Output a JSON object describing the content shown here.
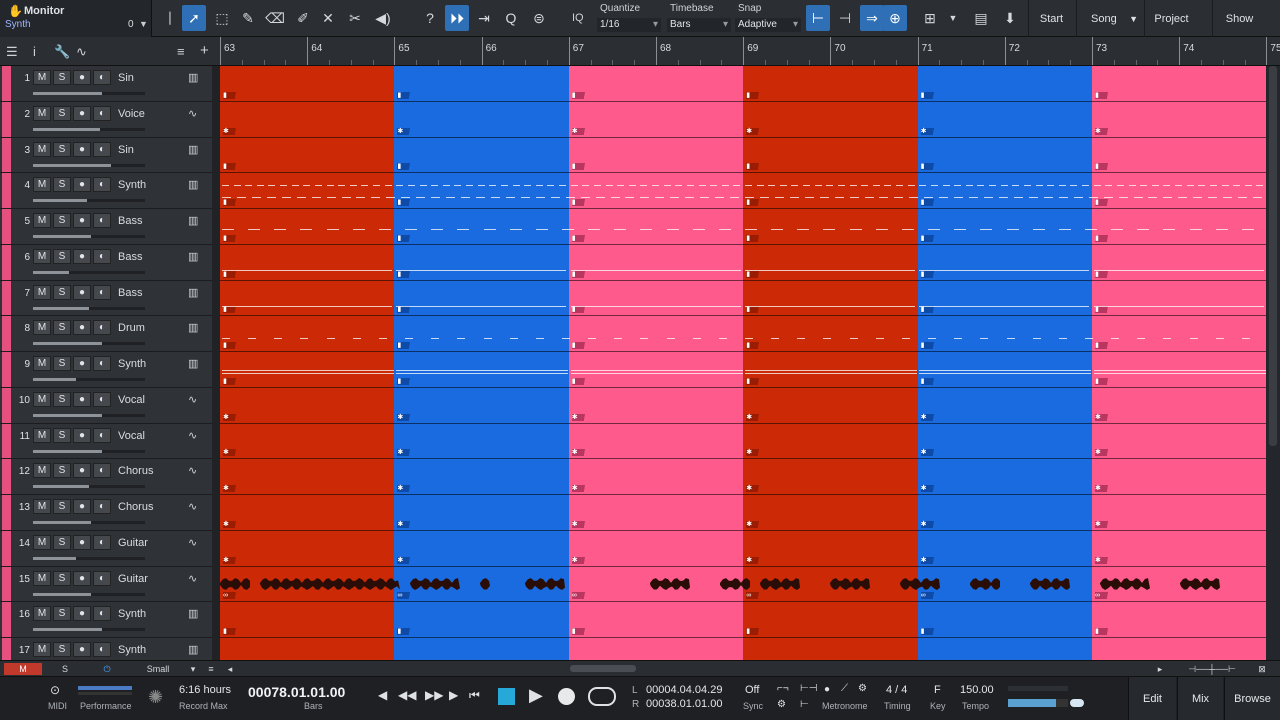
{
  "monitor": {
    "title": "Monitor",
    "track": "Synth",
    "value": "0"
  },
  "toolbar": {
    "iq": "IQ",
    "quantize_label": "Quantize",
    "quantize_value": "1/16",
    "timebase_label": "Timebase",
    "timebase_value": "Bars",
    "snap_label": "Snap",
    "snap_value": "Adaptive",
    "start": "Start",
    "song": "Song",
    "project": "Project",
    "show": "Show"
  },
  "ruler": {
    "bars": [
      "63",
      "64",
      "65",
      "66",
      "67",
      "68",
      "69",
      "70",
      "71",
      "72",
      "73",
      "74",
      "75"
    ]
  },
  "tracks": [
    {
      "num": "1",
      "name": "Sin",
      "type": "instrument",
      "vol": 0.62
    },
    {
      "num": "2",
      "name": "Voice",
      "type": "audio",
      "vol": 0.6
    },
    {
      "num": "3",
      "name": "Sin",
      "type": "instrument",
      "vol": 0.7
    },
    {
      "num": "4",
      "name": "Synth",
      "type": "instrument",
      "vol": 0.48
    },
    {
      "num": "5",
      "name": "Bass",
      "type": "instrument",
      "vol": 0.52
    },
    {
      "num": "6",
      "name": "Bass",
      "type": "instrument",
      "vol": 0.32
    },
    {
      "num": "7",
      "name": "Bass",
      "type": "instrument",
      "vol": 0.5
    },
    {
      "num": "8",
      "name": "Drum",
      "type": "instrument",
      "vol": 0.62
    },
    {
      "num": "9",
      "name": "Synth",
      "type": "instrument",
      "vol": 0.38
    },
    {
      "num": "10",
      "name": "Vocal",
      "type": "audio",
      "vol": 0.62
    },
    {
      "num": "11",
      "name": "Vocal",
      "type": "audio",
      "vol": 0.62
    },
    {
      "num": "12",
      "name": "Chorus",
      "type": "audio",
      "vol": 0.5
    },
    {
      "num": "13",
      "name": "Chorus",
      "type": "audio",
      "vol": 0.52
    },
    {
      "num": "14",
      "name": "Guitar",
      "type": "audio",
      "vol": 0.38
    },
    {
      "num": "15",
      "name": "Guitar",
      "type": "audio",
      "vol": 0.52
    },
    {
      "num": "16",
      "name": "Synth",
      "type": "instrument",
      "vol": 0.62
    },
    {
      "num": "17",
      "name": "Synth",
      "type": "instrument",
      "vol": 0.55
    }
  ],
  "track_buttons": {
    "mute": "M",
    "solo": "S"
  },
  "sections": [
    {
      "color": "#cc2a06"
    },
    {
      "color": "#1a6be0"
    },
    {
      "color": "#ff5a8c"
    },
    {
      "color": "#cc2a06"
    },
    {
      "color": "#1a6be0"
    },
    {
      "color": "#ff5a8c"
    }
  ],
  "bottom_bar": {
    "m": "M",
    "s": "S",
    "size": "Small"
  },
  "transport": {
    "midi": "MIDI",
    "performance": "Performance",
    "record_time": "6:16 hours",
    "record_max": "Record Max",
    "position": "00078.01.01.00",
    "position_unit": "Bars",
    "loop_l_label": "L",
    "loop_l": "00004.04.04.29",
    "loop_r_label": "R",
    "loop_r": "00038.01.01.00",
    "sync_value": "Off",
    "sync_label": "Sync",
    "metronome": "Metronome",
    "timing_value": "4 / 4",
    "timing_label": "Timing",
    "key_value": "F",
    "key_label": "Key",
    "tempo_value": "150.00",
    "tempo_label": "Tempo",
    "edit": "Edit",
    "mix": "Mix",
    "browse": "Browse"
  },
  "colors": {
    "accent": "#2e6fb5",
    "track_strip": "#e6507f"
  }
}
